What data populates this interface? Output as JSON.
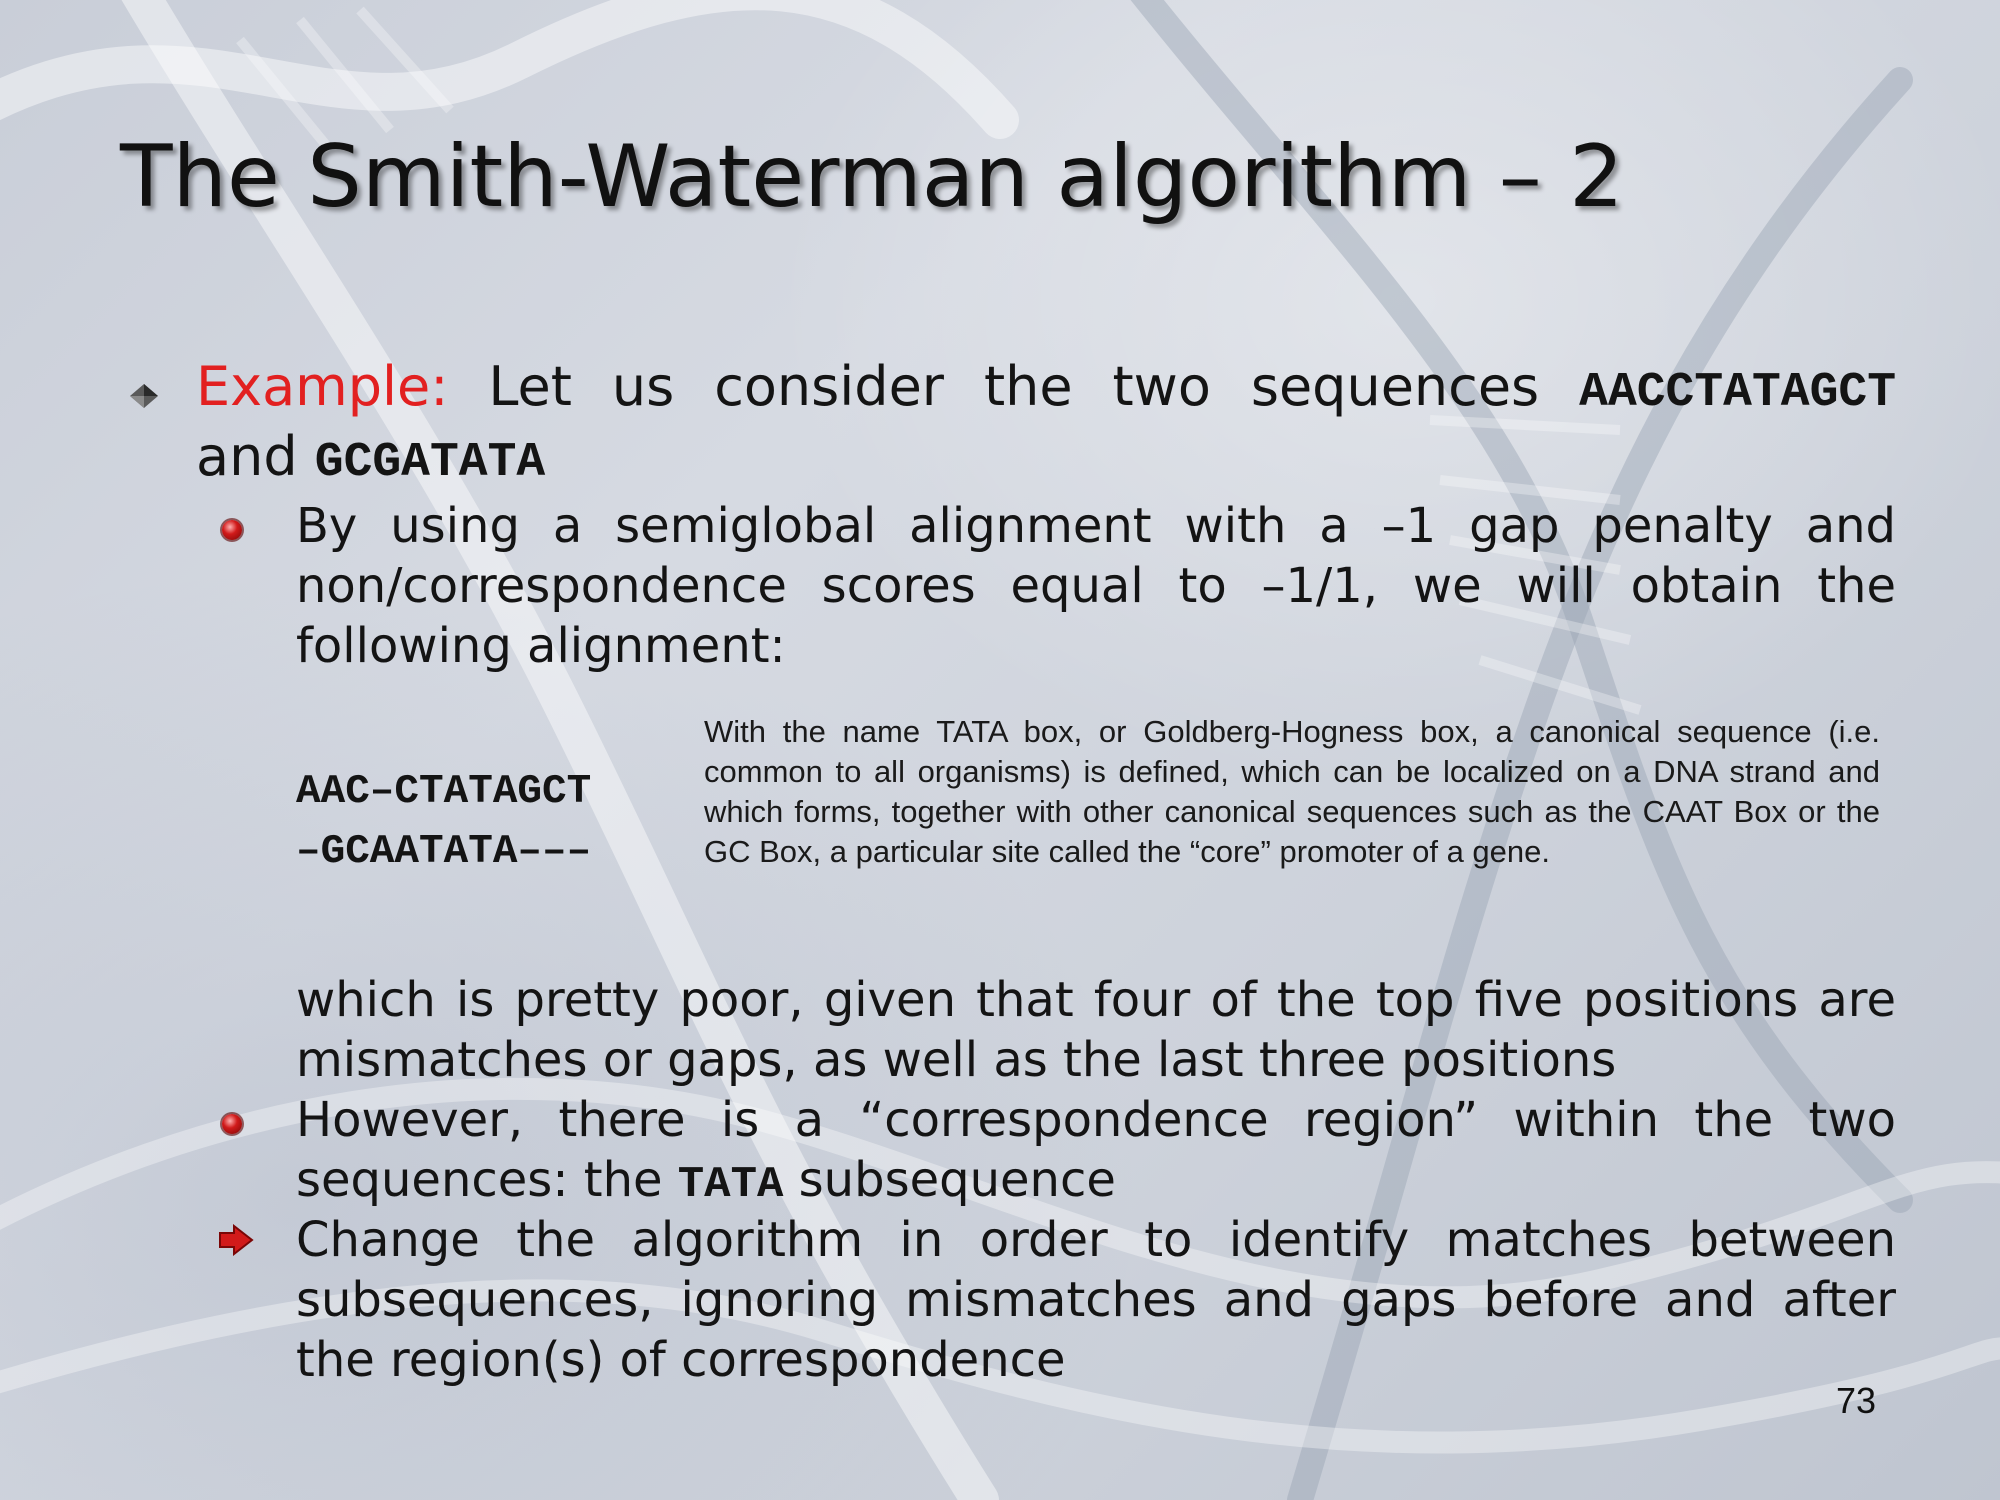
{
  "slide": {
    "title": "The Smith-Waterman algorithm – 2",
    "example": {
      "label": "Example:",
      "text": "Let us consider the two sequences",
      "seq1": "AACCTATAGCT",
      "and": "and",
      "seq2": "GCGATATA"
    },
    "bullet_semiglobal": "By using a semiglobal alignment with a –1 gap penalty and non/correspondence scores equal to –1/1, we will obtain the following alignment:",
    "alignment": {
      "line1": "AAC–CTATAGCT",
      "line2": "–GCAATATA–––"
    },
    "tata_note": "With the name TATA box, or Goldberg-Hogness box, a canonical sequence (i.e. common to all organisms) is defined, which can be localized on a DNA strand and which forms, together with other canonical sequences such as the CAAT Box or the GC Box, a particular site called the “core” promoter of a gene.",
    "poor_alignment_text": "which is pretty poor, given that four of the top five positions are mismatches or gaps, as well as the last three positions",
    "bullet_region": {
      "before": "However, there is a “correspondence region” within the two sequences: the",
      "code": "TATA",
      "after": "subsequence"
    },
    "bullet_change": "Change the algorithm in order to identify matches between subsequences, ignoring mismatches and gaps before and after the region(s) of correspondence",
    "page_number": "73"
  },
  "colors": {
    "label_red": "#e22020",
    "bullet_red": "#d11a1a",
    "text": "#141414"
  },
  "icons": [
    "diamond-bullet-icon",
    "red-dot-bullet-icon",
    "red-arrow-bullet-icon"
  ]
}
